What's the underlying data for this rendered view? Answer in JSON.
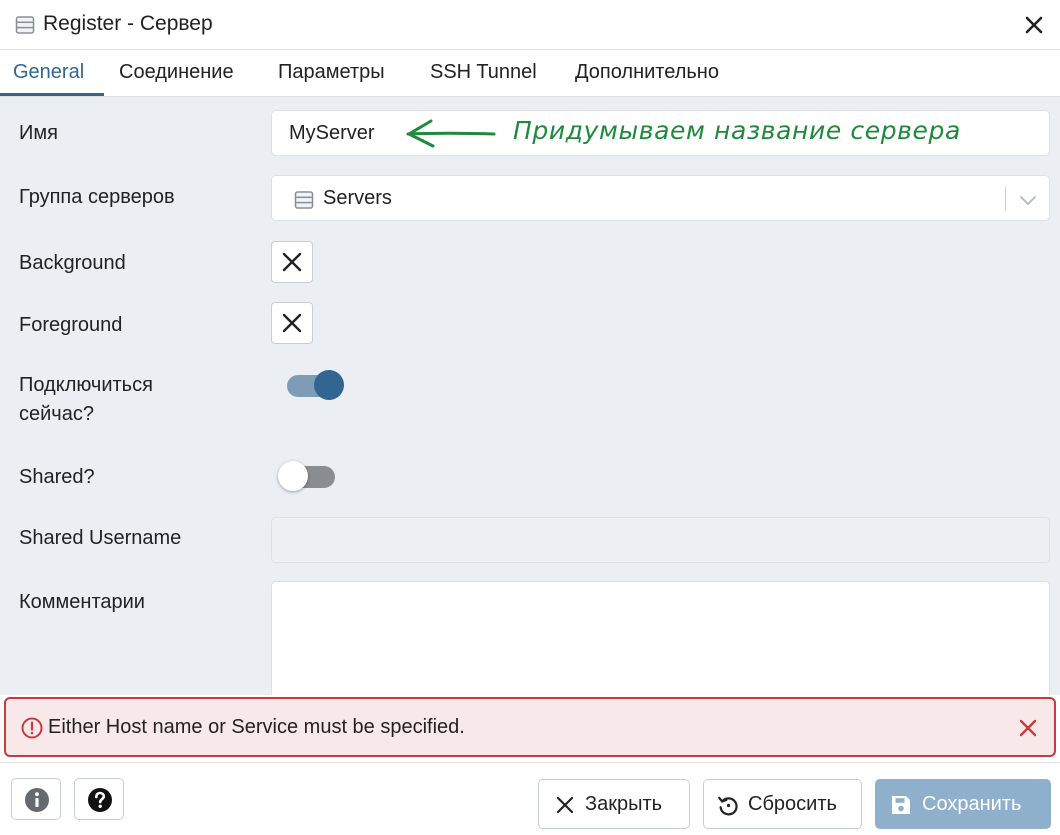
{
  "titlebar": {
    "title": "Register - Сервер"
  },
  "tabs": [
    {
      "label": "General",
      "active": true
    },
    {
      "label": "Соединение",
      "active": false
    },
    {
      "label": "Параметры",
      "active": false
    },
    {
      "label": "SSH Tunnel",
      "active": false
    },
    {
      "label": "Дополнительно",
      "active": false
    }
  ],
  "form": {
    "name": {
      "label": "Имя",
      "value": "MyServer"
    },
    "annotation": "Придумываем название сервера",
    "server_group": {
      "label": "Группа серверов",
      "value": "Servers"
    },
    "background": {
      "label": "Background"
    },
    "foreground": {
      "label": "Foreground"
    },
    "connect_now": {
      "label_line1": "Подключиться",
      "label_line2": "сейчас?",
      "checked": true
    },
    "shared": {
      "label": "Shared?",
      "checked": false
    },
    "shared_username": {
      "label": "Shared Username",
      "value": ""
    },
    "comments": {
      "label": "Комментарии",
      "value": ""
    }
  },
  "error": {
    "message": "Either Host name or Service must be specified."
  },
  "footer": {
    "close_label": "Закрыть",
    "reset_label": "Сбросить",
    "save_label": "Сохранить"
  },
  "colors": {
    "accent": "#326690",
    "form_background": "#ebeef3",
    "error_border": "#c83a3e",
    "error_background": "#f8e8ea",
    "annotation": "#1f8a3c",
    "save_button": "#8fb0cc"
  },
  "icons": [
    "server-icon",
    "close-icon",
    "server-group-icon",
    "chevron-down-icon",
    "clear-color-icon",
    "error-circle-icon",
    "info-icon",
    "help-icon",
    "reset-icon",
    "save-icon"
  ]
}
